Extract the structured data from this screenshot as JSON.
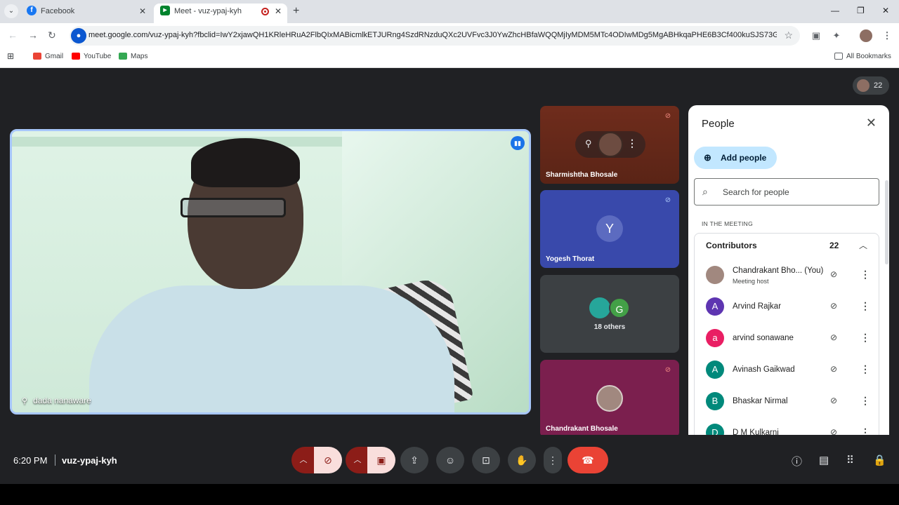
{
  "browser": {
    "tabs": [
      {
        "title": "Facebook",
        "icon": "facebook-icon",
        "color": "#1877f2"
      },
      {
        "title": "Meet - vuz-ypaj-kyh",
        "icon": "meet-icon",
        "color": "#00832d"
      }
    ],
    "url": "meet.google.com/vuz-ypaj-kyh?fbclid=IwY2xjawQH1KRleHRuA2FlbQIxMABicmlkETJURng4SzdRNzduQXc2UVFvc3J0YwZhcHBfaWQQMjIyMDM5MTc4ODIwMDg5MgABHkqaPHE6B3Cf400kuSJS73Gf...",
    "bookmarks": [
      {
        "label": "Gmail",
        "color": "#ea4335"
      },
      {
        "label": "YouTube",
        "color": "#ff0000"
      },
      {
        "label": "Maps",
        "color": "#34a853"
      }
    ],
    "all_bookmarks": "All Bookmarks"
  },
  "meeting": {
    "participant_count": "22",
    "main_speaker": "dada nanaware",
    "tiles": [
      {
        "name": "Sharmishtha Bhosale",
        "color": "#6f2c1c"
      },
      {
        "name": "Yogesh Thorat",
        "initial": "Y",
        "color": "#3949ab"
      },
      {
        "others": "18 others",
        "initial": "G"
      },
      {
        "name": "Chandrakant Bhosale",
        "color": "#7b1f4e"
      }
    ],
    "time": "6:20 PM",
    "code": "vuz-ypaj-kyh"
  },
  "people_panel": {
    "title": "People",
    "add_people": "Add people",
    "search_placeholder": "Search for people",
    "section_label": "IN THE MEETING",
    "contributors_label": "Contributors",
    "contributors_count": "22",
    "people": [
      {
        "name": "Chandrakant Bho...",
        "tag": "(You)",
        "sub": "Meeting host",
        "initial": "",
        "color": "#a1887f"
      },
      {
        "name": "Arvind Rajkar",
        "initial": "A",
        "color": "#5e35b1"
      },
      {
        "name": "arvind sonawane",
        "initial": "a",
        "color": "#e91e63"
      },
      {
        "name": "Avinash Gaikwad",
        "initial": "A",
        "color": "#00897b"
      },
      {
        "name": "Bhaskar Nirmal",
        "initial": "B",
        "color": "#00897b"
      },
      {
        "name": "D M Kulkarni",
        "initial": "D",
        "color": "#00897b"
      }
    ]
  }
}
